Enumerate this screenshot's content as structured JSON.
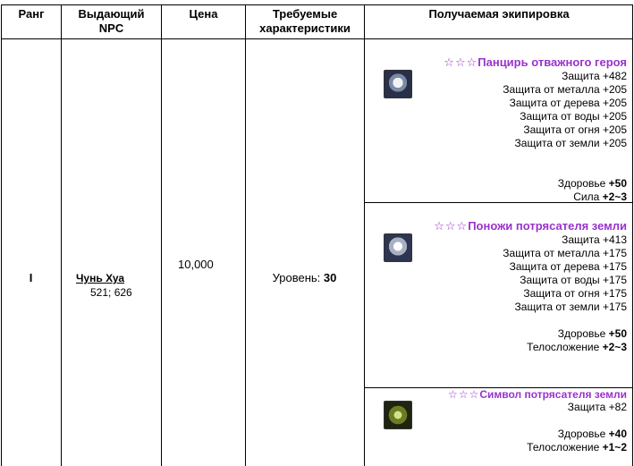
{
  "headers": {
    "rank": "Ранг",
    "npc_line1": "Выдающий",
    "npc_line2": "NPC",
    "price": "Цена",
    "req_line1": "Требуемые",
    "req_line2": "характеристики",
    "equip": "Получаемая экипировка"
  },
  "row": {
    "rank": "I",
    "npc_name": "Чунь Хуа",
    "npc_coords": "521; 626",
    "price": "10,000",
    "req_label": "Уровень:",
    "req_value": "30"
  },
  "items": [
    {
      "stars": "☆☆☆",
      "name": "Панцирь отважного героя",
      "icon": "armor-icon",
      "stats": [
        "Защита +482",
        "Защита от металла +205",
        "Защита от дерева +205",
        "Защита от воды +205",
        "Защита от огня +205",
        "Защита от земли +205"
      ],
      "bonus": [
        {
          "label": "Здоровье ",
          "value": "+50"
        },
        {
          "label": "Сила ",
          "value": "+2~3"
        }
      ]
    },
    {
      "stars": "☆☆☆",
      "name": "Поножи потрясателя земли",
      "icon": "leggings-icon",
      "stats": [
        "Защита +413",
        "Защита от металла +175",
        "Защита от дерева +175",
        "Защита от воды +175",
        "Защита от огня +175",
        "Защита от земли +175"
      ],
      "bonus": [
        {
          "label": "Здоровье ",
          "value": "+50"
        },
        {
          "label": "Телосложение ",
          "value": "+2~3"
        }
      ]
    },
    {
      "stars": "☆☆☆",
      "name": "Символ потрясателя земли",
      "icon": "amulet-icon",
      "stats": [
        "Защита +82"
      ],
      "bonus": [
        {
          "label": "Здоровье ",
          "value": "+40"
        },
        {
          "label": "Телосложение ",
          "value": "+1~2"
        }
      ]
    }
  ],
  "colors": {
    "item_title": "#9933cc",
    "border": "#000000"
  }
}
